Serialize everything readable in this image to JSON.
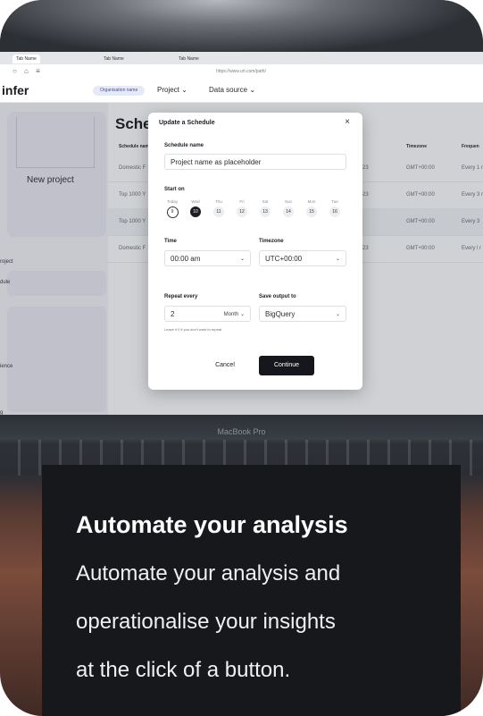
{
  "browser": {
    "tabs": [
      "Tab Name",
      "Tab Name",
      "Tab Name"
    ],
    "url": "https://www.url.com/path/"
  },
  "app": {
    "logo": "infer",
    "org_pill": "Organisation name",
    "menu_project": "Project",
    "menu_datasource": "Data source"
  },
  "sidebar": {
    "new_project": "New project",
    "items": [
      "roject",
      "dule",
      "ience",
      "g",
      "eddia"
    ]
  },
  "main": {
    "title": "Sched",
    "columns": [
      "Schedule name",
      "Timezone",
      "Frequen"
    ],
    "rows": [
      {
        "name": "Domestic F",
        "date": "04/2023",
        "tz": "GMT+00:00",
        "freq": "Every 1 r"
      },
      {
        "name": "Top 1000 Y",
        "date": "04/2023",
        "tz": "GMT+00:00",
        "freq": "Every 3 r"
      },
      {
        "name": "Top 1000 Y",
        "date": "",
        "tz": "GMT+00:00",
        "freq": "Every 3"
      },
      {
        "name": "Domestic F",
        "date": "04/2023",
        "tz": "GMT+00:00",
        "freq": "Every l r"
      }
    ]
  },
  "modal": {
    "title": "Update a Schedule",
    "close": "×",
    "schedule_name_label": "Schedule name",
    "schedule_name_value": "Project name as placeholder",
    "start_on_label": "Start on",
    "days": [
      {
        "name": "Today",
        "num": "9"
      },
      {
        "name": "Wed",
        "num": "10"
      },
      {
        "name": "Thu",
        "num": "11"
      },
      {
        "name": "Fri",
        "num": "12"
      },
      {
        "name": "Sat",
        "num": "13"
      },
      {
        "name": "Sun",
        "num": "14"
      },
      {
        "name": "Mon",
        "num": "15"
      },
      {
        "name": "Tue",
        "num": "16"
      }
    ],
    "time_label": "Time",
    "time_value": "00:00 am",
    "timezone_label": "Timezone",
    "timezone_value": "UTC+00:00",
    "repeat_label": "Repeat every",
    "repeat_value": "2",
    "repeat_unit": "Month",
    "output_label": "Save output to",
    "output_value": "BigQuery",
    "hint": "Leave it 0 if you don't want to repeat",
    "cancel": "Cancel",
    "continue": "Continue"
  },
  "device_label": "MacBook Pro",
  "promo": {
    "headline": "Automate your analysis",
    "lines": [
      "Automate your analysis and",
      "operationalise your insights",
      "at the click of a button."
    ]
  },
  "colors": {
    "panel_bg": "#17181c",
    "primary_button": "#15171c",
    "org_pill_text": "#3d4fb0"
  }
}
